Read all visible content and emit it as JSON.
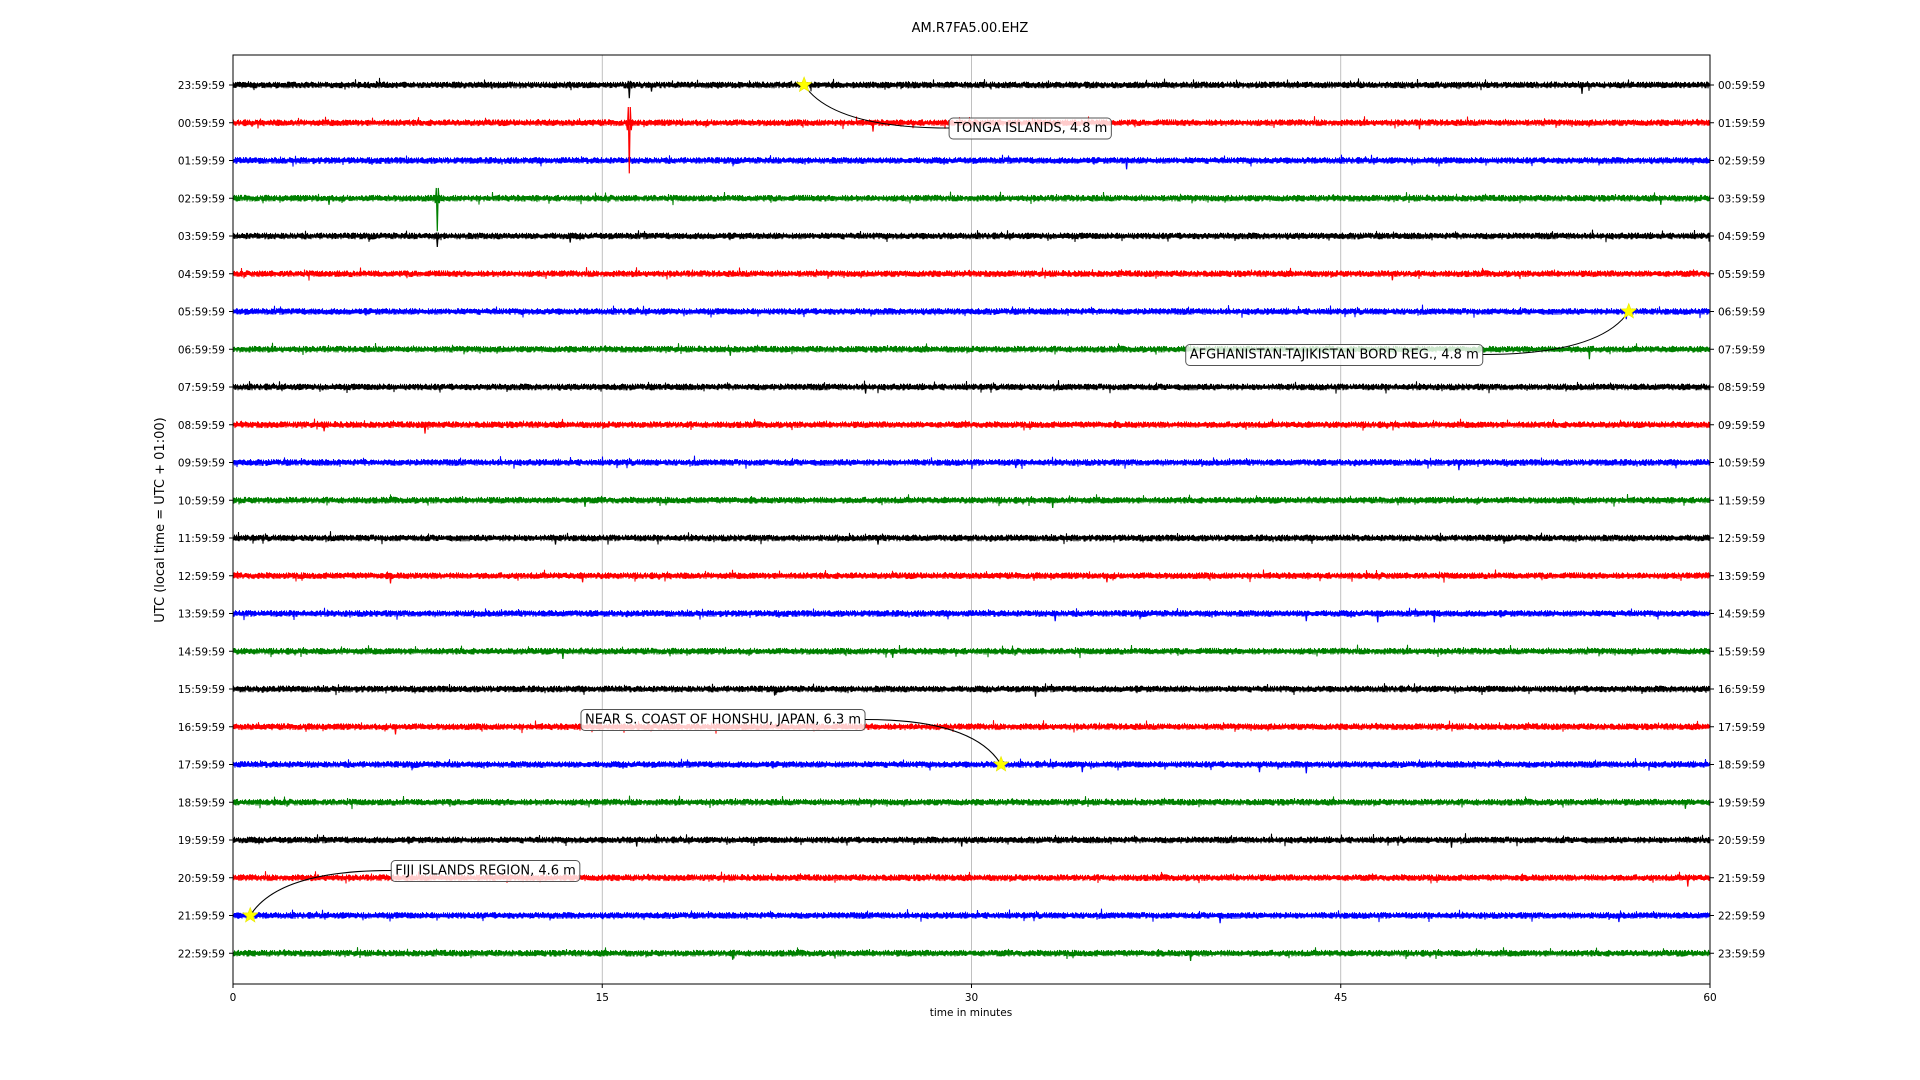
{
  "chart_data": {
    "type": "line",
    "title": "AM.R7FA5.00.EHZ",
    "xlabel": "time in minutes",
    "ylabel": "UTC (local time = UTC + 01:00)",
    "xlim": [
      0,
      60
    ],
    "x_ticks": [
      0,
      15,
      30,
      45,
      60
    ],
    "vertical_grid": true,
    "trace_colors": [
      "#000000",
      "#ff0000",
      "#0000ff",
      "#008000"
    ],
    "rows": [
      {
        "left": "23:59:59",
        "right": "00:59:59"
      },
      {
        "left": "00:59:59",
        "right": "01:59:59"
      },
      {
        "left": "01:59:59",
        "right": "02:59:59"
      },
      {
        "left": "02:59:59",
        "right": "03:59:59"
      },
      {
        "left": "03:59:59",
        "right": "04:59:59"
      },
      {
        "left": "04:59:59",
        "right": "05:59:59"
      },
      {
        "left": "05:59:59",
        "right": "06:59:59"
      },
      {
        "left": "06:59:59",
        "right": "07:59:59"
      },
      {
        "left": "07:59:59",
        "right": "08:59:59"
      },
      {
        "left": "08:59:59",
        "right": "09:59:59"
      },
      {
        "left": "09:59:59",
        "right": "10:59:59"
      },
      {
        "left": "10:59:59",
        "right": "11:59:59"
      },
      {
        "left": "11:59:59",
        "right": "12:59:59"
      },
      {
        "left": "12:59:59",
        "right": "13:59:59"
      },
      {
        "left": "13:59:59",
        "right": "14:59:59"
      },
      {
        "left": "14:59:59",
        "right": "15:59:59"
      },
      {
        "left": "15:59:59",
        "right": "16:59:59"
      },
      {
        "left": "16:59:59",
        "right": "17:59:59"
      },
      {
        "left": "17:59:59",
        "right": "18:59:59"
      },
      {
        "left": "18:59:59",
        "right": "19:59:59"
      },
      {
        "left": "19:59:59",
        "right": "20:59:59"
      },
      {
        "left": "20:59:59",
        "right": "21:59:59"
      },
      {
        "left": "21:59:59",
        "right": "22:59:59"
      },
      {
        "left": "22:59:59",
        "right": "23:59:59"
      }
    ],
    "events": [
      {
        "label": "TONGA ISLANDS, 4.8 m",
        "row": 0,
        "minute": 23.2,
        "callout_side": "below-right"
      },
      {
        "label": "AFGHANISTAN-TAJIKISTAN BORD REG., 4.8 m",
        "row": 6,
        "minute": 56.7,
        "callout_side": "below-left"
      },
      {
        "label": "NEAR S. COAST OF HONSHU, JAPAN, 6.3 m",
        "row": 18,
        "minute": 31.2,
        "callout_side": "above-left"
      },
      {
        "label": "FIJI ISLANDS REGION, 4.6 m",
        "row": 22,
        "minute": 0.7,
        "callout_side": "above-right"
      }
    ],
    "spikes": [
      {
        "row": 0,
        "minute": 16.1,
        "amplitude": 0.6
      },
      {
        "row": 0,
        "minute": 17.0,
        "amplitude": 0.3
      },
      {
        "row": 0,
        "minute": 54.8,
        "amplitude": 0.4
      },
      {
        "row": 1,
        "minute": 16.1,
        "amplitude": 2.3
      },
      {
        "row": 1,
        "minute": 26.0,
        "amplitude": 0.4
      },
      {
        "row": 1,
        "minute": 48.2,
        "amplitude": 0.3
      },
      {
        "row": 2,
        "minute": 36.3,
        "amplitude": 0.4
      },
      {
        "row": 3,
        "minute": 8.3,
        "amplitude": 1.5
      },
      {
        "row": 3,
        "minute": 3.9,
        "amplitude": 0.3
      },
      {
        "row": 3,
        "minute": 58.0,
        "amplitude": 0.3
      },
      {
        "row": 4,
        "minute": 8.3,
        "amplitude": 0.5
      },
      {
        "row": 4,
        "minute": 13.7,
        "amplitude": 0.3
      },
      {
        "row": 5,
        "minute": 47.1,
        "amplitude": 0.3
      },
      {
        "row": 6,
        "minute": 56.6,
        "amplitude": 0.35
      },
      {
        "row": 7,
        "minute": 20.2,
        "amplitude": 0.3
      },
      {
        "row": 7,
        "minute": 55.1,
        "amplitude": 0.45
      },
      {
        "row": 8,
        "minute": 25.7,
        "amplitude": 0.3
      },
      {
        "row": 9,
        "minute": 7.8,
        "amplitude": 0.4
      },
      {
        "row": 9,
        "minute": 3.7,
        "amplitude": 0.3
      },
      {
        "row": 10,
        "minute": 49.8,
        "amplitude": 0.35
      },
      {
        "row": 10,
        "minute": 31.8,
        "amplitude": 0.25
      },
      {
        "row": 11,
        "minute": 33.3,
        "amplitude": 0.35
      },
      {
        "row": 11,
        "minute": 14.3,
        "amplitude": 0.3
      },
      {
        "row": 12,
        "minute": 26.2,
        "amplitude": 0.3
      },
      {
        "row": 12,
        "minute": 13.1,
        "amplitude": 0.3
      },
      {
        "row": 13,
        "minute": 6.4,
        "amplitude": 0.35
      },
      {
        "row": 13,
        "minute": 14.2,
        "amplitude": 0.3
      },
      {
        "row": 13,
        "minute": 35.5,
        "amplitude": 0.3
      },
      {
        "row": 14,
        "minute": 33.4,
        "amplitude": 0.35
      },
      {
        "row": 14,
        "minute": 43.6,
        "amplitude": 0.35
      },
      {
        "row": 14,
        "minute": 46.5,
        "amplitude": 0.4
      },
      {
        "row": 14,
        "minute": 48.8,
        "amplitude": 0.4
      },
      {
        "row": 15,
        "minute": 13.4,
        "amplitude": 0.35
      },
      {
        "row": 15,
        "minute": 26.8,
        "amplitude": 0.3
      },
      {
        "row": 16,
        "minute": 32.6,
        "amplitude": 0.35
      },
      {
        "row": 16,
        "minute": 22.0,
        "amplitude": 0.3
      },
      {
        "row": 17,
        "minute": 6.6,
        "amplitude": 0.35
      },
      {
        "row": 18,
        "minute": 34.5,
        "amplitude": 0.35
      },
      {
        "row": 18,
        "minute": 41.7,
        "amplitude": 0.35
      },
      {
        "row": 18,
        "minute": 43.6,
        "amplitude": 0.4
      },
      {
        "row": 19,
        "minute": 59.0,
        "amplitude": 0.3
      },
      {
        "row": 20,
        "minute": 49.5,
        "amplitude": 0.35
      },
      {
        "row": 20,
        "minute": 29.6,
        "amplitude": 0.3
      },
      {
        "row": 20,
        "minute": 16.4,
        "amplitude": 0.3
      },
      {
        "row": 21,
        "minute": 59.1,
        "amplitude": 0.4
      },
      {
        "row": 22,
        "minute": 40.1,
        "amplitude": 0.35
      },
      {
        "row": 22,
        "minute": 56.3,
        "amplitude": 0.3
      },
      {
        "row": 23,
        "minute": 38.9,
        "amplitude": 0.35
      },
      {
        "row": 23,
        "minute": 20.3,
        "amplitude": 0.3
      }
    ]
  }
}
